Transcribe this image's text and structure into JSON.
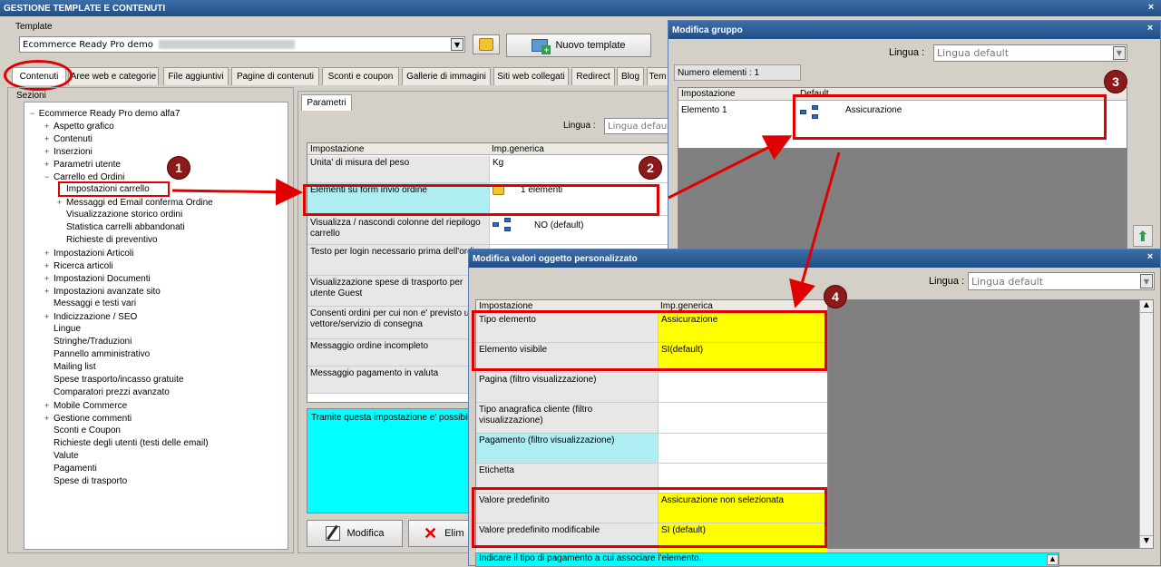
{
  "main": {
    "title": "GESTIONE TEMPLATE E CONTENUTI",
    "close": "×",
    "template_label": "Template",
    "template_value": "Ecommerce Ready Pro demo",
    "new_template_label": "Nuovo template",
    "tabs": [
      "Contenuti",
      "Aree web e categorie",
      "File aggiuntivi",
      "Pagine di contenuti",
      "Sconti e coupon",
      "Gallerie di immagini",
      "Siti web collegati",
      "Redirect",
      "Blog",
      "Tem"
    ],
    "sezioni_label": "Sezioni",
    "tree_root": "Ecommerce Ready Pro demo alfa7",
    "tree_items": [
      {
        "label": "Aspetto grafico",
        "exp": "+"
      },
      {
        "label": "Contenuti",
        "exp": "+"
      },
      {
        "label": "Inserzioni",
        "exp": "+"
      },
      {
        "label": "Parametri utente",
        "exp": "+"
      },
      {
        "label": "Carrello ed Ordini",
        "exp": "−"
      },
      {
        "label": "Impostazioni carrello",
        "exp": ""
      },
      {
        "label": "Messaggi ed Email conferma Ordine",
        "exp": "+"
      },
      {
        "label": "Visualizzazione storico ordini",
        "exp": ""
      },
      {
        "label": "Statistica carrelli abbandonati",
        "exp": ""
      },
      {
        "label": "Richieste di preventivo",
        "exp": ""
      },
      {
        "label": "Impostazioni Articoli",
        "exp": "+"
      },
      {
        "label": "Ricerca articoli",
        "exp": "+"
      },
      {
        "label": "Impostazioni Documenti",
        "exp": "+"
      },
      {
        "label": "Impostazioni avanzate sito",
        "exp": "+"
      },
      {
        "label": "Messaggi e testi vari",
        "exp": ""
      },
      {
        "label": "Indicizzazione / SEO",
        "exp": "+"
      },
      {
        "label": "Lingue",
        "exp": ""
      },
      {
        "label": "Stringhe/Traduzioni",
        "exp": ""
      },
      {
        "label": "Pannello amministrativo",
        "exp": ""
      },
      {
        "label": "Mailing list",
        "exp": ""
      },
      {
        "label": "Spese trasporto/incasso gratuite",
        "exp": ""
      },
      {
        "label": "Comparatori prezzi avanzato",
        "exp": ""
      },
      {
        "label": "Mobile Commerce",
        "exp": "+"
      },
      {
        "label": "Gestione commenti",
        "exp": "+"
      },
      {
        "label": "Sconti e Coupon",
        "exp": ""
      },
      {
        "label": "Richieste degli utenti (testi delle email)",
        "exp": ""
      },
      {
        "label": "Valute",
        "exp": ""
      },
      {
        "label": "Pagamenti",
        "exp": ""
      },
      {
        "label": "Spese di trasporto",
        "exp": ""
      }
    ],
    "parametri_tab": "Parametri",
    "lingua_label": "Lingua :",
    "lingua_value": "Lingua default",
    "grid_headers": [
      "Impostazione",
      "Imp.generica"
    ],
    "grid_rows": [
      {
        "label": "Unita' di misura del peso",
        "value": "Kg"
      },
      {
        "label": "Elementi su form invio ordine",
        "value": "1 elementi"
      },
      {
        "label": "Visualizza / nascondi colonne del riepilogo carrello",
        "value": "NO (default)"
      },
      {
        "label": "Testo per login necessario prima dell'ordine",
        "value": ""
      },
      {
        "label": "Visualizzazione spese di trasporto per utente Guest",
        "value": ""
      },
      {
        "label": "Consenti ordini per cui non e' previsto un vettore/servizio di consegna",
        "value": ""
      },
      {
        "label": "Messaggio ordine incompleto",
        "value": ""
      },
      {
        "label": "Messaggio pagamento in valuta",
        "value": ""
      }
    ],
    "description": "Tramite questa impostazione e' possibile",
    "modifica_label": "Modifica",
    "elimina_label": "Elim"
  },
  "gruppo": {
    "title": "Modifica gruppo",
    "close": "×",
    "lingua_label": "Lingua :",
    "lingua_value": "Lingua default",
    "count_label": "Numero elementi : 1",
    "headers": [
      "Impostazione",
      "Default"
    ],
    "row_label": "Elemento 1",
    "row_value": "Assicurazione"
  },
  "oggetto": {
    "title": "Modifica valori oggetto personalizzato",
    "close": "×",
    "lingua_label": "Lingua :",
    "lingua_value": "Lingua default",
    "headers": [
      "Impostazione",
      "Imp.generica"
    ],
    "rows": [
      {
        "label": "Tipo elemento",
        "value": "Assicurazione"
      },
      {
        "label": "Elemento visibile",
        "value": "SI(default)"
      },
      {
        "label": "Pagina (filtro visualizzazione)",
        "value": ""
      },
      {
        "label": "Tipo anagrafica cliente (filtro visualizzazione)",
        "value": ""
      },
      {
        "label": "Pagamento (filtro visualizzazione)",
        "value": ""
      },
      {
        "label": "Etichetta",
        "value": ""
      },
      {
        "label": "Valore predefinito",
        "value": "Assicurazione non selezionata"
      },
      {
        "label": "Valore predefinito modificabile",
        "value": "SI (default)"
      }
    ],
    "description": "Indicare il tipo di pagamento a cui associare l'elemento."
  },
  "badges": [
    "1",
    "2",
    "3",
    "4"
  ],
  "colors": {
    "titlebar": "#1f4f86",
    "highlight_red": "#e00000",
    "yellow": "#ffff00",
    "cyan": "#00ffff",
    "selection": "#aeeef2"
  }
}
